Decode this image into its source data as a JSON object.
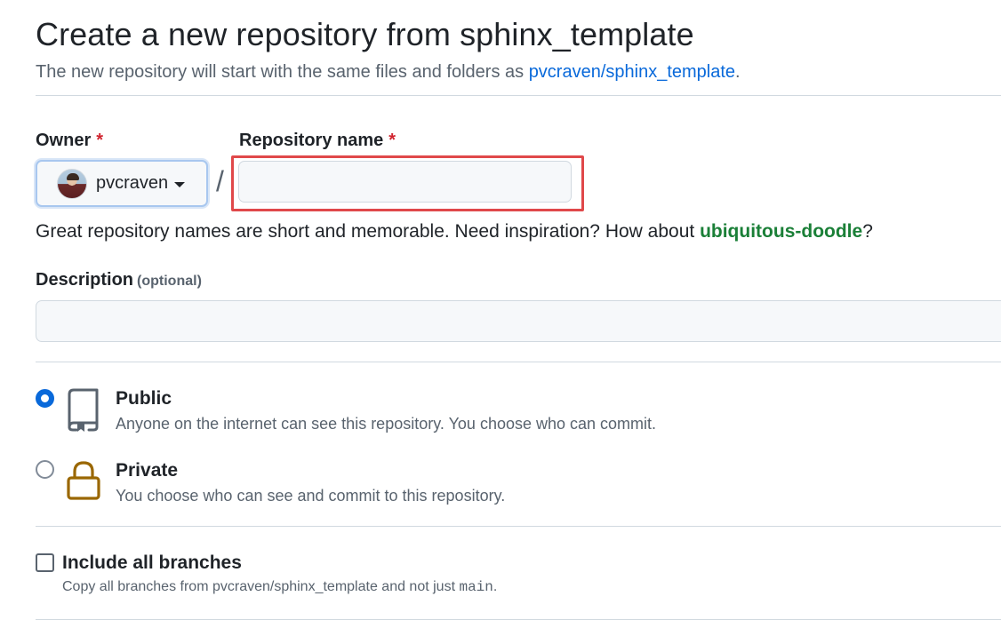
{
  "header": {
    "title": "Create a new repository from sphinx_template",
    "subtitle_prefix": "The new repository will start with the same files and folders as ",
    "template_link": "pvcraven/sphinx_template",
    "subtitle_suffix": "."
  },
  "owner": {
    "label": "Owner",
    "required_mark": "*",
    "selected": "pvcraven"
  },
  "separator": "/",
  "repo_name": {
    "label": "Repository name",
    "required_mark": "*",
    "value": "",
    "hint_prefix": "Great repository names are short and memorable. Need inspiration? How about ",
    "suggestion": "ubiquitous-doodle",
    "hint_suffix": "?"
  },
  "description": {
    "label": "Description",
    "optional": "(optional)",
    "value": ""
  },
  "visibility": {
    "selected": "public",
    "options": [
      {
        "id": "public",
        "title": "Public",
        "desc": "Anyone on the internet can see this repository. You choose who can commit."
      },
      {
        "id": "private",
        "title": "Private",
        "desc": "You choose who can see and commit to this repository."
      }
    ]
  },
  "branches": {
    "label": "Include all branches",
    "checked": false,
    "desc_prefix": "Copy all branches from pvcraven/sphinx_template and not just ",
    "desc_code": "main",
    "desc_suffix": "."
  },
  "colors": {
    "accent": "#0969da",
    "required": "#d1242f",
    "suggestion": "#1a7f37",
    "highlight": "#e0484a",
    "lock": "#9a6700"
  }
}
